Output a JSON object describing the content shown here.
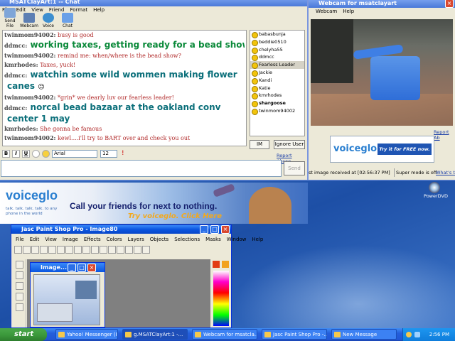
{
  "chat_window": {
    "title": "MSATClayArt:1 -- Chat",
    "menu": [
      "File",
      "Edit",
      "View",
      "Friend",
      "Format",
      "Help"
    ],
    "toolbar": [
      "Send File",
      "Webcam",
      "Voice",
      "Chat"
    ],
    "messages": [
      {
        "user": "twinmom94002:",
        "text": "busy is good",
        "style": "red"
      },
      {
        "user": "ddmcc:",
        "text": "working taxes, getting ready for a bead show",
        "style": "big-green"
      },
      {
        "user": "twinmom94002:",
        "text": "remind me: when/where is the bead show?",
        "style": "red"
      },
      {
        "user": "kmrhodes:",
        "text": "Taxes, yuck!",
        "style": "red"
      },
      {
        "user": "ddmcc:",
        "text": "watchin some wild wommen making flower",
        "style": "big-teal"
      },
      {
        "user": "",
        "text": "canes",
        "style": "big-teal"
      },
      {
        "user": "twinmom94002:",
        "text": "*grin* we dearly luv our fearless leader!",
        "style": "red"
      },
      {
        "user": "ddmcc:",
        "text": "norcal bead bazaar at the oakland conv",
        "style": "big-teal"
      },
      {
        "user": "",
        "text": "center 1 may",
        "style": "big-teal"
      },
      {
        "user": "kmrhodes:",
        "text": "She gonna be famous",
        "style": "red"
      },
      {
        "user": "twinmom94002:",
        "text": "kewl....i'll try to BART over and check you out",
        "style": "red"
      }
    ],
    "buddies": [
      "babasbunja",
      "beddie0510",
      "chelyha55",
      "ddmcc",
      "Fearless Leader",
      "Jackie",
      "Kandi",
      "Katie",
      "kmrhodes",
      "shargoose",
      "twinmom94002"
    ],
    "selected_buddy": "Fearless Leader",
    "im_button": "IM",
    "ignore_button": "Ignore User",
    "report_abuse": "Report Abuse",
    "font": "Arial",
    "font_size": "12",
    "send_button": "Send"
  },
  "banner": {
    "brand": "voiceglo",
    "tagline": "talk. talk. talk. talk. to any phone in the world",
    "headline": "Call your friends for next to nothing.",
    "cta": "Try voiceglo. Click Here"
  },
  "webcam": {
    "title": "Webcam for msatclayart",
    "menu": [
      "Webcam",
      "Help"
    ],
    "report": "Report Ab",
    "ad_brand": "voiceglo",
    "ad_cta": "Try it for FREE now.",
    "status_left": "st image received at [02:56:37 PM]",
    "status_mid": "Super mode is off -",
    "status_link": "What's th"
  },
  "psp": {
    "title": "Jasc Paint Shop Pro - Image80",
    "menu": [
      "File",
      "Edit",
      "View",
      "Image",
      "Effects",
      "Colors",
      "Layers",
      "Objects",
      "Selections",
      "Masks",
      "Window",
      "Help"
    ],
    "image_title": "Image..."
  },
  "desktop_icon": "PowerDVD",
  "taskbar": {
    "start": "start",
    "tasks": [
      "Yahoo! Messenger (I...",
      "g.MSATClayArt:1 -...",
      "Webcam for msatcla...",
      "Jasc Paint Shop Pro -...",
      "New Message"
    ],
    "clock": "2:56 PM"
  }
}
